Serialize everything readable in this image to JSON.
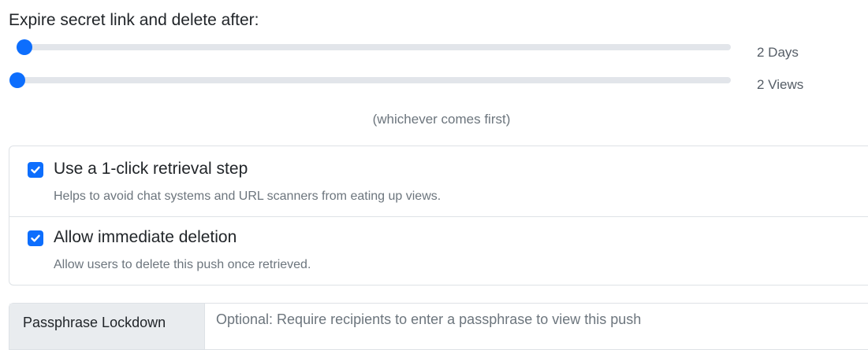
{
  "expire": {
    "label": "Expire secret link and delete after:",
    "days": {
      "value_label": "2 Days",
      "fraction": 0.01
    },
    "views": {
      "value_label": "2 Views",
      "fraction": 0.0
    },
    "note": "(whichever comes first)"
  },
  "options": [
    {
      "title": "Use a 1-click retrieval step",
      "description": "Helps to avoid chat systems and URL scanners from eating up views.",
      "checked": true
    },
    {
      "title": "Allow immediate deletion",
      "description": "Allow users to delete this push once retrieved.",
      "checked": true
    }
  ],
  "passphrase": {
    "label": "Passphrase Lockdown",
    "placeholder": "Optional: Require recipients to enter a passphrase to view this push"
  },
  "colors": {
    "accent": "#0d6efd",
    "track": "#e2e5ea",
    "border": "#dee2e6"
  },
  "icons": {
    "checkbox": "check-icon"
  }
}
